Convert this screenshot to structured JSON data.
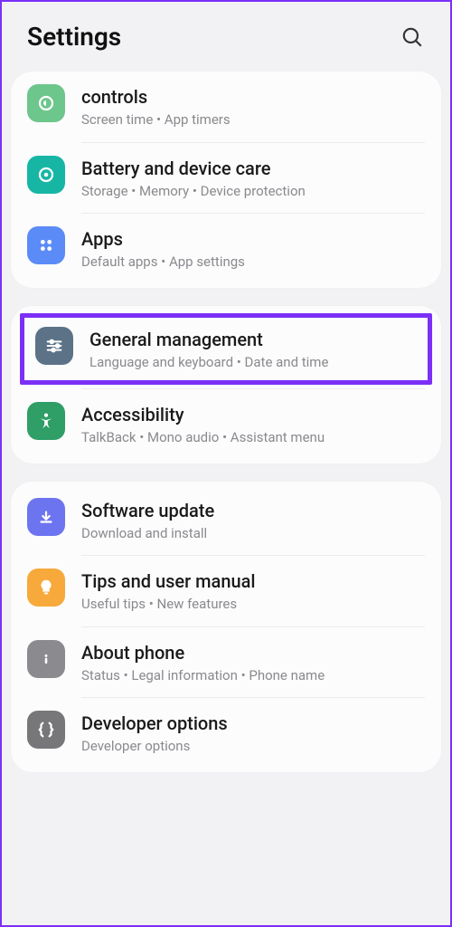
{
  "header": {
    "title": "Settings"
  },
  "groups": [
    {
      "items": [
        {
          "title": "controls",
          "sub": "Screen time  •  App timers"
        },
        {
          "title": "Battery and device care",
          "sub": "Storage  •  Memory  •  Device protection"
        },
        {
          "title": "Apps",
          "sub": "Default apps  •  App settings"
        }
      ]
    },
    {
      "items": [
        {
          "title": "General management",
          "sub": "Language and keyboard  •  Date and time"
        },
        {
          "title": "Accessibility",
          "sub": "TalkBack  •  Mono audio  •  Assistant menu"
        }
      ]
    },
    {
      "items": [
        {
          "title": "Software update",
          "sub": "Download and install"
        },
        {
          "title": "Tips and user manual",
          "sub": "Useful tips  •  New features"
        },
        {
          "title": "About phone",
          "sub": "Status  •  Legal information  •  Phone name"
        },
        {
          "title": "Developer options",
          "sub": "Developer options"
        }
      ]
    }
  ]
}
